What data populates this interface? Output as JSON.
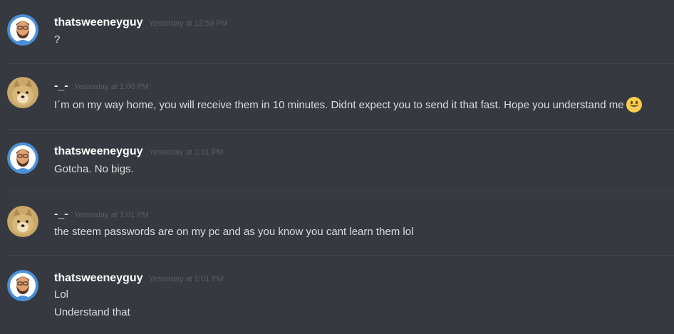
{
  "messages": [
    {
      "author": "thatsweeneyguy",
      "avatar": "bearded-man-avatar",
      "timestamp": "Yesterday at 12:59 PM",
      "lines": [
        "?"
      ]
    },
    {
      "author": "-_-",
      "avatar": "doge-avatar",
      "timestamp": "Yesterday at 1:00 PM",
      "lines": [
        "I´m on my way home, you will receive them in 10 minutes. Didnt expect you to send it that fast. Hope you understand me"
      ],
      "emoji": "smiley-emoji"
    },
    {
      "author": "thatsweeneyguy",
      "avatar": "bearded-man-avatar",
      "timestamp": "Yesterday at 1:01 PM",
      "lines": [
        "Gotcha. No bigs."
      ]
    },
    {
      "author": "-_-",
      "avatar": "doge-avatar",
      "timestamp": "Yesterday at 1:01 PM",
      "lines": [
        "the steem passwords are on my pc and as you know you cant learn them lol"
      ]
    },
    {
      "author": "thatsweeneyguy",
      "avatar": "bearded-man-avatar",
      "timestamp": "Yesterday at 1:01 PM",
      "lines": [
        "Lol",
        "Understand that"
      ]
    }
  ],
  "colors": {
    "background": "#36393f",
    "username": "#ffffff",
    "text": "#dcddde",
    "timestamp": "#5a5d63",
    "divider": "#40444b"
  }
}
